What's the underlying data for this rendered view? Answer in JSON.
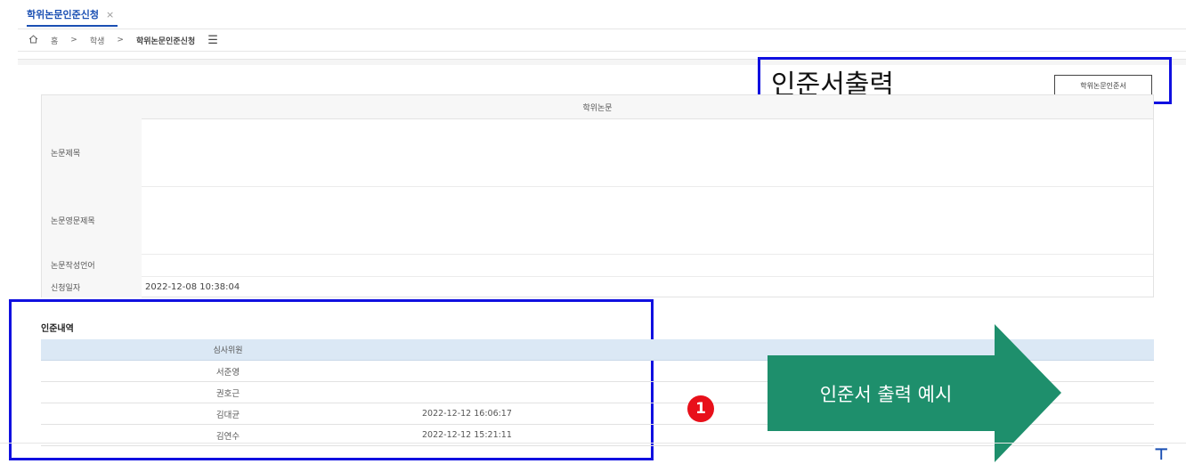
{
  "tab": {
    "label": "학위논문인준신청",
    "close_glyph": "×"
  },
  "breadcrumb": {
    "home_icon": "home-icon",
    "home_label": "홈",
    "sep": ">",
    "level1": "학생",
    "level2": "학위논문인준신청",
    "menu_icon": "hamburger-icon"
  },
  "certificate": {
    "title": "인준서출력",
    "button_label": "학위논문인준서"
  },
  "thesis": {
    "section_header": "학위논문",
    "rows": [
      {
        "label": "논문제목",
        "value": ""
      },
      {
        "label": "논문영문제목",
        "value": ""
      },
      {
        "label": "논문작성언어",
        "value": ""
      },
      {
        "label": "신청일자",
        "value": "2022-12-08 10:38:04"
      }
    ]
  },
  "approvals": {
    "title": "인준내역",
    "column_header": "심사위원",
    "rows": [
      {
        "name": "서준영",
        "date": ""
      },
      {
        "name": "권호근",
        "date": ""
      },
      {
        "name": "김대균",
        "date": "2022-12-12 16:06:17"
      },
      {
        "name": "김연수",
        "date": "2022-12-12 15:21:11"
      }
    ]
  },
  "annotation": {
    "badge": "1",
    "arrow_label": "인준서 출력 예시",
    "arrow_color": "#1e8f6c",
    "highlight_color": "#1010e0",
    "badge_color": "#e8101a"
  }
}
